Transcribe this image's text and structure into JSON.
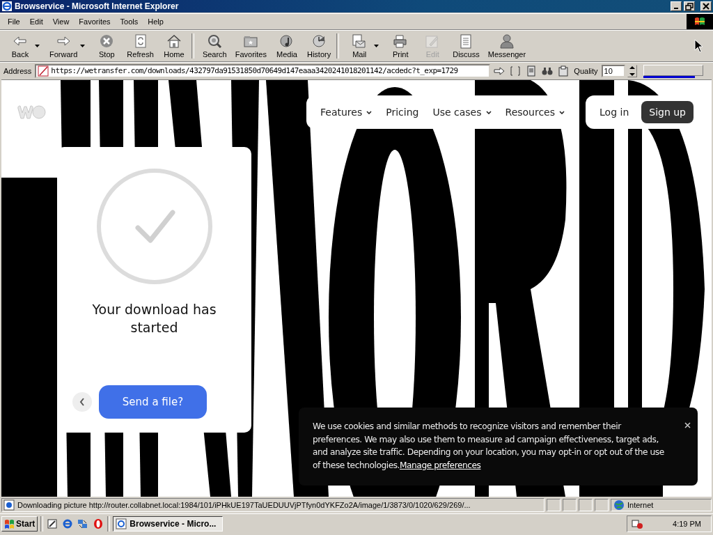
{
  "window": {
    "title": "Browservice - Microsoft Internet Explorer"
  },
  "menu": [
    "File",
    "Edit",
    "View",
    "Favorites",
    "Tools",
    "Help"
  ],
  "toolbar": [
    [
      {
        "label": "Back",
        "kind": "back",
        "dropdown": true,
        "disabled": false
      },
      {
        "label": "Forward",
        "kind": "forward",
        "dropdown": true,
        "disabled": false
      },
      {
        "label": "Stop",
        "kind": "stop",
        "dropdown": false,
        "disabled": false
      },
      {
        "label": "Refresh",
        "kind": "refresh",
        "dropdown": false,
        "disabled": false
      },
      {
        "label": "Home",
        "kind": "home",
        "dropdown": false,
        "disabled": false
      }
    ],
    [
      {
        "label": "Search",
        "kind": "search",
        "dropdown": false,
        "disabled": false
      },
      {
        "label": "Favorites",
        "kind": "favorites",
        "dropdown": false,
        "disabled": false
      },
      {
        "label": "Media",
        "kind": "media",
        "dropdown": false,
        "disabled": false
      },
      {
        "label": "History",
        "kind": "history",
        "dropdown": false,
        "disabled": false
      }
    ],
    [
      {
        "label": "Mail",
        "kind": "mail",
        "dropdown": true,
        "disabled": false
      },
      {
        "label": "Print",
        "kind": "print",
        "dropdown": false,
        "disabled": false
      },
      {
        "label": "Edit",
        "kind": "edit",
        "dropdown": false,
        "disabled": true
      },
      {
        "label": "Discuss",
        "kind": "discuss",
        "dropdown": false,
        "disabled": false
      },
      {
        "label": "Messenger",
        "kind": "messenger",
        "dropdown": false,
        "disabled": false
      }
    ]
  ],
  "address": {
    "label": "Address",
    "url": "https://wetransfer.com/downloads/432797da91531850d70649d147eaaa3420241018201142/acdedc?t_exp=1729"
  },
  "quality": {
    "label": "Quality",
    "value": "10"
  },
  "download_progress": {
    "level": 0.86
  },
  "page": {
    "nav": [
      {
        "label": "Features",
        "dropdown": true
      },
      {
        "label": "Pricing",
        "dropdown": false
      },
      {
        "label": "Use cases",
        "dropdown": true
      },
      {
        "label": "Resources",
        "dropdown": true
      }
    ],
    "login": "Log in",
    "signup": "Sign up",
    "card": {
      "message": "Your download has started",
      "button": "Send a file?"
    },
    "cookie": {
      "text": "We use cookies and similar methods to recognize visitors and remember their preferences. We may also use them to measure ad campaign effectiveness, target ads, and analyze site traffic. Depending on your location, you may opt-in or opt out of the use of these technologies.",
      "link": "Manage preferences"
    }
  },
  "status_bar": {
    "text": "Downloading picture http://router.collabnet.local:1984/101/iPHkUE197TaUEDUUVjPTfyn0dYKFZo2A/image/1/3873/0/1020/629/269/...",
    "zone": "Internet"
  },
  "taskbar": {
    "start": "Start",
    "task": "Browservice - Micro...",
    "time": "4:19 PM"
  }
}
